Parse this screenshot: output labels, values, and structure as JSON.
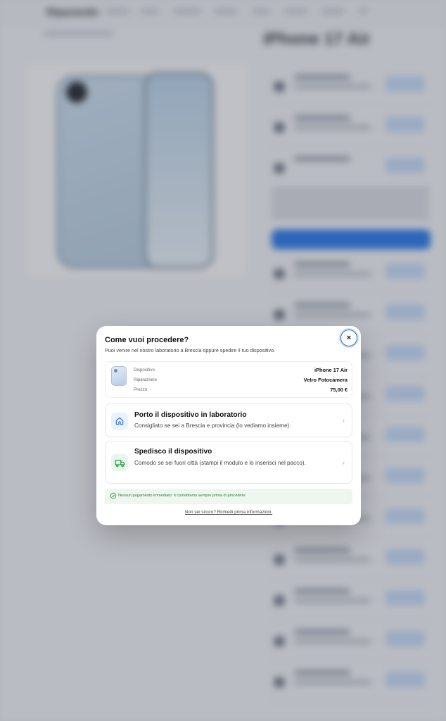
{
  "background": {
    "site_name": "Riparando",
    "product_title": "iPhone 17 Air"
  },
  "modal": {
    "title": "Come vuoi procedere?",
    "subtitle": "Puoi venire nel nostro laboratorio a Brescia oppure spedire il tuo dispositivo.",
    "close_label": "×",
    "summary": {
      "device_label": "Dispositivo",
      "device_value": "iPhone 17 Air",
      "repair_label": "Riparazione",
      "repair_value": "Vetro Fotocamera",
      "price_label": "Prezzo",
      "price_value": "75,00 €"
    },
    "options": [
      {
        "title": "Porto il dispositivo in laboratorio",
        "description": "Consigliato se sei a Brescia e provincia (lo vediamo insieme).",
        "icon": "house-icon"
      },
      {
        "title": "Spedisco il dispositivo",
        "description": "Comodo se sei fuori città (stampi il modulo e lo inserisci nel pacco).",
        "icon": "truck-icon"
      }
    ],
    "notice": "Nessun pagamento immediato: ti contattiamo sempre prima di procedere.",
    "help_link": "Non sei sicuro? Richiedi prima informazioni."
  },
  "colors": {
    "accent_blue": "#1e6fd9",
    "notice_green": "#2f7a3a",
    "notice_bg": "#eef7ef"
  }
}
